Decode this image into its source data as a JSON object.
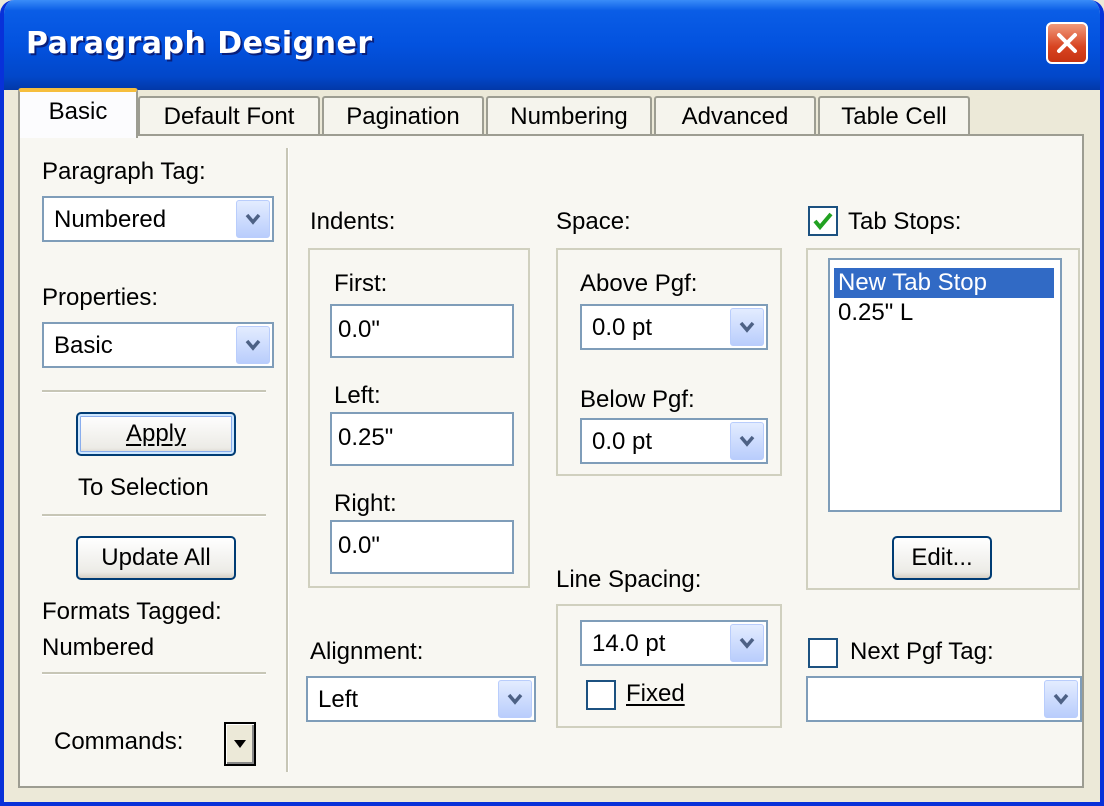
{
  "window": {
    "title": "Paragraph Designer"
  },
  "tabs": [
    "Basic",
    "Default Font",
    "Pagination",
    "Numbering",
    "Advanced",
    "Table Cell"
  ],
  "left": {
    "paragraph_tag_label": "Paragraph Tag:",
    "paragraph_tag_value": "Numbered",
    "properties_label": "Properties:",
    "properties_value": "Basic",
    "apply_button": "Apply",
    "apply_caption": "To Selection",
    "update_all_button": "Update All",
    "formats_tagged_label": "Formats Tagged:",
    "formats_tagged_value": "Numbered",
    "commands_label": "Commands:"
  },
  "indents": {
    "label": "Indents:",
    "first_label": "First:",
    "first_value": "0.0\"",
    "left_label": "Left:",
    "left_value": "0.25\"",
    "right_label": "Right:",
    "right_value": "0.0\""
  },
  "space": {
    "label": "Space:",
    "above_label": "Above Pgf:",
    "above_value": "0.0 pt",
    "below_label": "Below Pgf:",
    "below_value": "0.0 pt"
  },
  "line_spacing": {
    "label": "Line Spacing:",
    "value": "14.0 pt",
    "fixed_label": "Fixed",
    "fixed_checked": false
  },
  "alignment": {
    "label": "Alignment:",
    "value": "Left"
  },
  "tab_stops": {
    "label": "Tab Stops:",
    "checked": true,
    "items": [
      "New Tab Stop",
      "0.25\"  L"
    ],
    "edit_button": "Edit..."
  },
  "next_pgf": {
    "label": "Next Pgf Tag:",
    "checked": false,
    "value": ""
  }
}
